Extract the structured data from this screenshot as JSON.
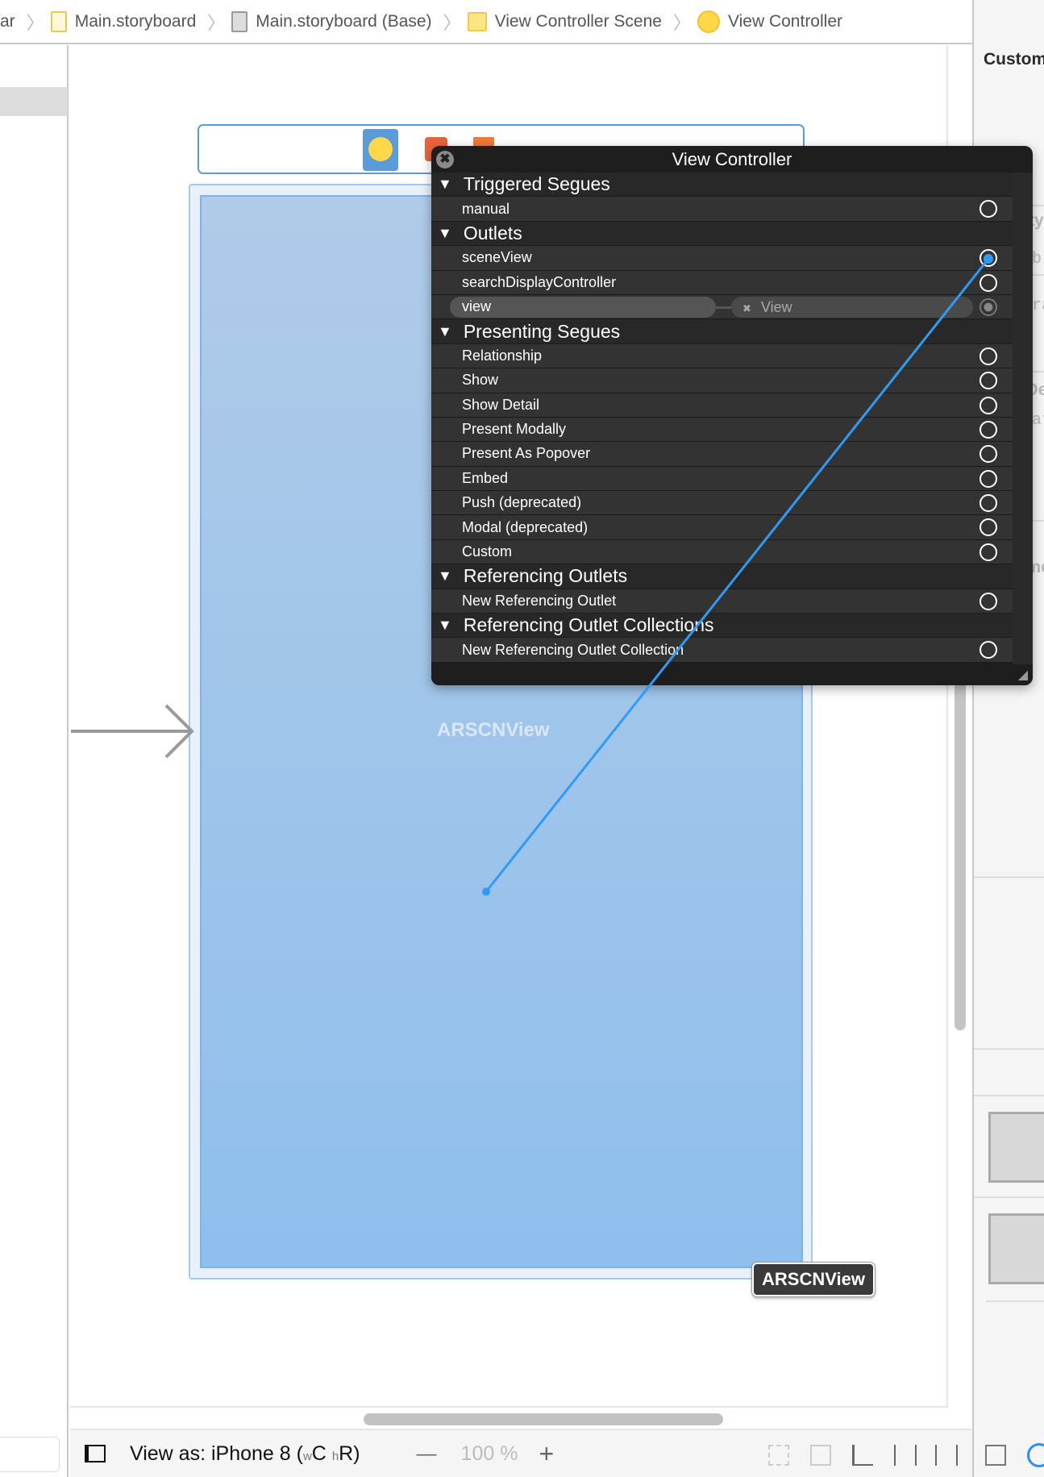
{
  "breadcrumb": [
    {
      "label": "ar",
      "icon": "none"
    },
    {
      "label": "Main.storyboard",
      "icon": "storyboard-file-icon"
    },
    {
      "label": "Main.storyboard (Base)",
      "icon": "storyboard-base-icon"
    },
    {
      "label": "View Controller Scene",
      "icon": "scene-icon"
    },
    {
      "label": "View Controller",
      "icon": "view-controller-icon"
    }
  ],
  "canvas": {
    "view_label": "ARSCNView",
    "selected_badge": "ARSCNView"
  },
  "popup": {
    "title": "View Controller",
    "rows": [
      {
        "type": "header",
        "label": "Triggered Segues"
      },
      {
        "type": "item",
        "label": "manual"
      },
      {
        "type": "header",
        "label": "Outlets"
      },
      {
        "type": "item",
        "label": "sceneView",
        "state": "connecting"
      },
      {
        "type": "item",
        "label": "searchDisplayController"
      },
      {
        "type": "item",
        "label": "view",
        "connected_to": "View",
        "state": "connected"
      },
      {
        "type": "header",
        "label": "Presenting Segues"
      },
      {
        "type": "item",
        "label": "Relationship"
      },
      {
        "type": "item",
        "label": "Show"
      },
      {
        "type": "item",
        "label": "Show Detail"
      },
      {
        "type": "item",
        "label": "Present Modally"
      },
      {
        "type": "item",
        "label": "Present As Popover"
      },
      {
        "type": "item",
        "label": "Embed"
      },
      {
        "type": "item",
        "label": "Push (deprecated)"
      },
      {
        "type": "item",
        "label": "Modal (deprecated)"
      },
      {
        "type": "item",
        "label": "Custom"
      },
      {
        "type": "header",
        "label": "Referencing Outlets"
      },
      {
        "type": "item",
        "label": "New Referencing Outlet"
      },
      {
        "type": "header",
        "label": "Referencing Outlet Collections"
      },
      {
        "type": "item",
        "label": "New Referencing Outlet Collection"
      }
    ]
  },
  "inspector": {
    "custom": "Custom",
    "identity": "Identity",
    "storyboard": "Storyb",
    "restoration": "Restora",
    "user_defined": "User De",
    "key_path": "Key Pat",
    "document": "Docume",
    "other": "Ol"
  },
  "bottombar": {
    "view_as": "View as: iPhone 8 (",
    "w": "w",
    "c": "C",
    "h": "h",
    "r": "R)",
    "zoom": "100 %",
    "minus": "—",
    "plus": "+"
  },
  "colors": {
    "connection": "#2f9bf7",
    "view_top": "#b0cbe8",
    "view_bottom": "#8fbfed",
    "popup_bg": "#333333"
  }
}
